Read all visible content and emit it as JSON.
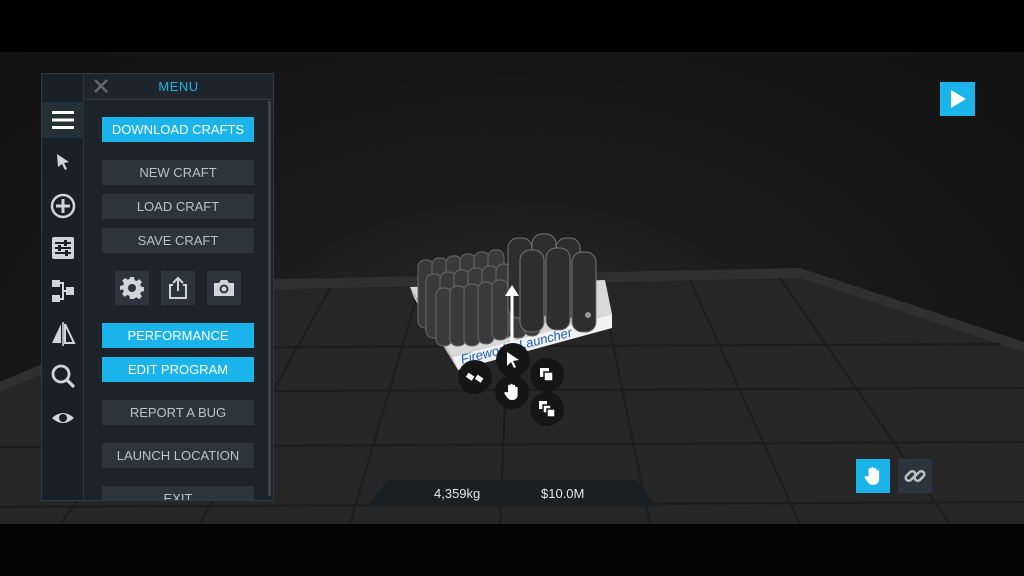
{
  "menu": {
    "title": "MENU",
    "buttons": {
      "download_crafts": "DOWNLOAD CRAFTS",
      "new_craft": "NEW CRAFT",
      "load_craft": "LOAD CRAFT",
      "save_craft": "SAVE CRAFT",
      "performance": "PERFORMANCE",
      "edit_program": "EDIT PROGRAM",
      "report_bug": "REPORT A BUG",
      "launch_location": "LAUNCH LOCATION",
      "exit": "EXIT"
    },
    "icon_buttons": [
      "gear-icon",
      "share-icon",
      "camera-icon"
    ]
  },
  "rail_icons": [
    "hamburger-icon",
    "pointer-icon",
    "add-part-icon",
    "sliders-icon",
    "staging-icon",
    "symmetry-icon",
    "search-icon",
    "eye-icon"
  ],
  "stats": {
    "mass": "4,359kg",
    "cost": "$10.0M"
  },
  "craft": {
    "label": "Fireworks Launcher"
  },
  "colors": {
    "accent": "#1ab4ea",
    "panel": "#1d2429",
    "button": "#2b353b"
  }
}
